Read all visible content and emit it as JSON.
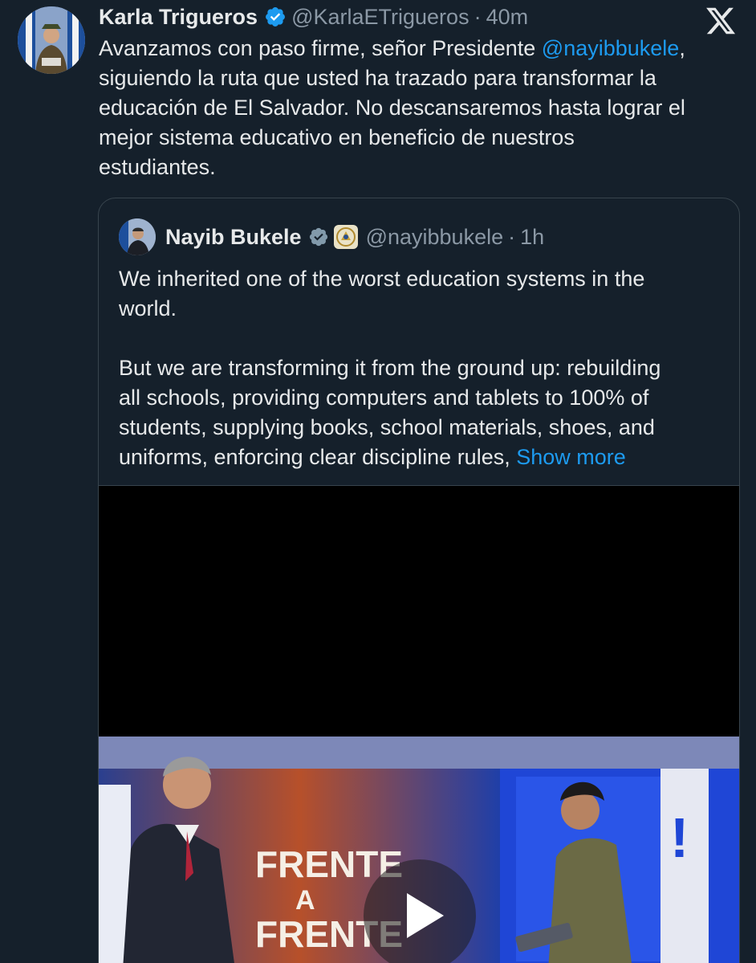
{
  "tweet": {
    "display_name": "Karla Trigueros",
    "handle": "@KarlaETrigueros",
    "separator": "·",
    "time": "40m",
    "text_before": "Avanzamos con paso firme, señor Presidente ",
    "mention": "@nayibbukele",
    "text_after": ",\nsiguiendo la ruta que usted ha trazado para transformar la\neducación de El Salvador. No descansaremos hasta lograr el\nmejor sistema educativo en beneficio de nuestros\nestudiantes."
  },
  "quote": {
    "display_name": "Nayib Bukele",
    "handle": "@nayibbukele",
    "separator": "·",
    "time": "1h",
    "text": "We inherited one of the worst education systems in the\nworld.\n\nBut we are transforming it from the ground up: rebuilding\nall schools, providing computers and tablets to 100% of\nstudents, supplying books, school materials, shoes, and\nuniforms, enforcing clear discipline rules, ",
    "show_more": "Show more"
  },
  "video": {
    "set_text_line1": "FRENTE",
    "set_text_line2": "A",
    "set_text_line3": "FRENTE"
  },
  "icons": {
    "verified": "verified-badge-icon",
    "government": "government-affiliation-icon",
    "x_logo": "x-logo-icon",
    "play": "play-icon"
  },
  "colors": {
    "background": "#15202b",
    "link": "#1d9bf0",
    "secondary_text": "#8b98a5",
    "border": "#38444d"
  }
}
